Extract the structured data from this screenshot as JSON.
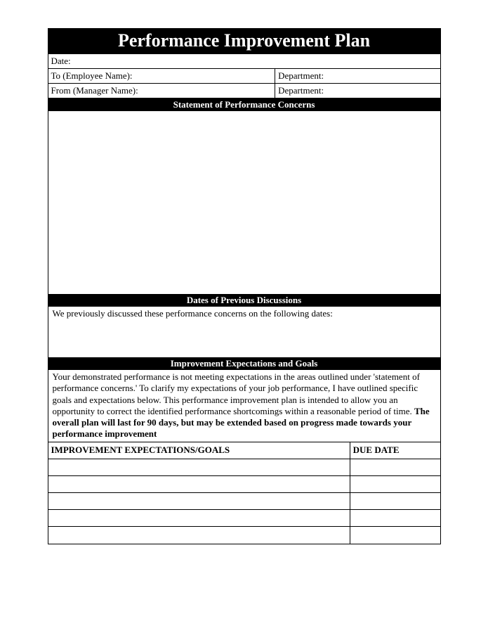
{
  "title": "Performance Improvement Plan",
  "fields": {
    "date_label": "Date:",
    "to_label": "To (Employee Name):",
    "to_dept_label": "Department:",
    "from_label": "From (Manager Name):",
    "from_dept_label": "Department:"
  },
  "sections": {
    "concerns_header": "Statement of Performance Concerns",
    "prev_header": "Dates of Previous Discussions",
    "prev_text": "We previously discussed these performance concerns on the following dates:",
    "goals_header": "Improvement Expectations and Goals",
    "goals_intro_regular": "Your demonstrated performance is not meeting expectations in the areas outlined under 'statement of performance concerns.' To clarify my expectations of your job performance, I have outlined specific goals and expectations below. This performance improvement plan is intended to allow you an opportunity to correct the identified performance shortcomings within a reasonable period of time. ",
    "goals_intro_bold": "The overall plan will last for 90 days, but may be extended based on progress made towards your performance improvement"
  },
  "goals_table": {
    "col1": "IMPROVEMENT EXPECTATIONS/GOALS",
    "col2": "DUE DATE",
    "rows": 5
  }
}
